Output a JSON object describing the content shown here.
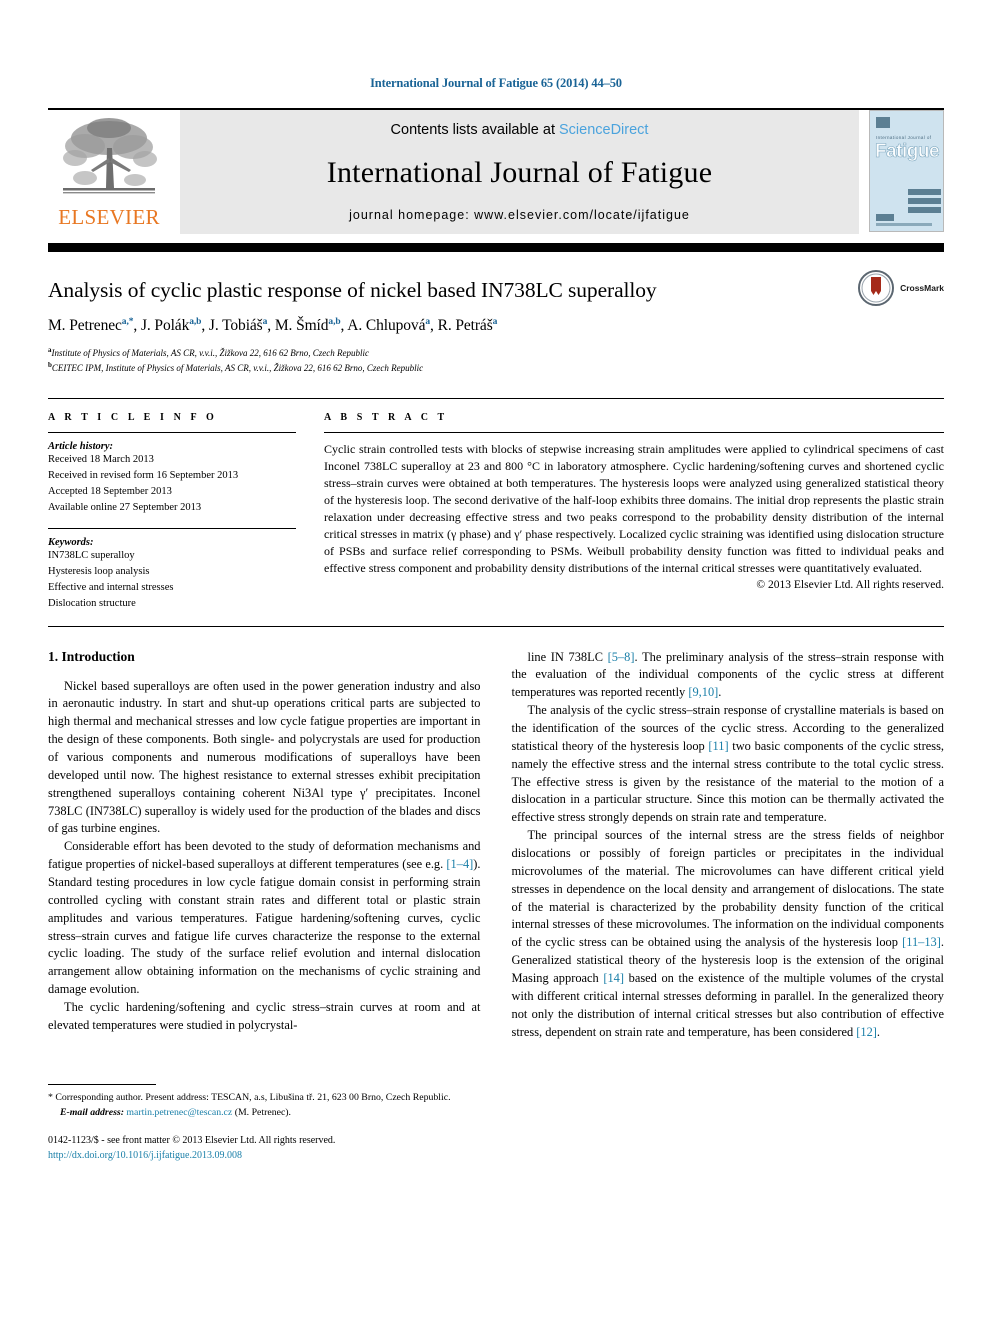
{
  "running_head": "International Journal of Fatigue 65 (2014) 44–50",
  "masthead": {
    "publisher_name": "ELSEVIER",
    "contents_prefix": "Contents lists available at ",
    "contents_link": "ScienceDirect",
    "journal_title": "International Journal of Fatigue",
    "homepage": "journal homepage: www.elsevier.com/locate/ijfatigue",
    "cover": {
      "top_label": "International Journal of",
      "big_word": "Fatigue"
    }
  },
  "article": {
    "title": "Analysis of cyclic plastic response of nickel based IN738LC superalloy",
    "crossmark_label": "CrossMark",
    "authors": [
      {
        "name": "M. Petrenec",
        "sup": "a,*"
      },
      {
        "name": "J. Polák",
        "sup": "a,b"
      },
      {
        "name": "J. Tobiáš",
        "sup": "a"
      },
      {
        "name": "M. Šmíd",
        "sup": "a,b"
      },
      {
        "name": "A. Chlupová",
        "sup": "a"
      },
      {
        "name": "R. Petráš",
        "sup": "a"
      }
    ],
    "affiliations": [
      {
        "marker": "a",
        "text": "Institute of Physics of Materials, AS CR, v.v.i., Žižkova 22, 616 62 Brno, Czech Republic"
      },
      {
        "marker": "b",
        "text": "CEITEC IPM, Institute of Physics of Materials, AS CR, v.v.i., Žižkova 22, 616 62 Brno, Czech Republic"
      }
    ]
  },
  "info": {
    "heading": "A R T I C L E    I N F O",
    "history_label": "Article history:",
    "history": [
      "Received 18 March 2013",
      "Received in revised form 16 September 2013",
      "Accepted 18 September 2013",
      "Available online 27 September 2013"
    ],
    "keywords_label": "Keywords:",
    "keywords": [
      "IN738LC superalloy",
      "Hysteresis loop analysis",
      "Effective and internal stresses",
      "Dislocation structure"
    ]
  },
  "abstract": {
    "heading": "A B S T R A C T",
    "text": "Cyclic strain controlled tests with blocks of stepwise increasing strain amplitudes were applied to cylindrical specimens of cast Inconel 738LC superalloy at 23 and 800 °C in laboratory atmosphere. Cyclic hardening/softening curves and shortened cyclic stress–strain curves were obtained at both temperatures. The hysteresis loops were analyzed using generalized statistical theory of the hysteresis loop. The second derivative of the half-loop exhibits three domains. The initial drop represents the plastic strain relaxation under decreasing effective stress and two peaks correspond to the probability density distribution of the internal critical stresses in matrix (γ phase) and γ′ phase respectively. Localized cyclic straining was identified using dislocation structure of PSBs and surface relief corresponding to PSMs. Weibull probability density function was fitted to individual peaks and effective stress component and probability density distributions of the internal critical stresses were quantitatively evaluated.",
    "copyright": "© 2013 Elsevier Ltd. All rights reserved."
  },
  "body": {
    "section1_heading": "1. Introduction",
    "left_paragraphs": [
      "Nickel based superalloys are often used in the power generation industry and also in aeronautic industry. In start and shut-up operations critical parts are subjected to high thermal and mechanical stresses and low cycle fatigue properties are important in the design of these components. Both single- and polycrystals are used for production of various components and numerous modifications of superalloys have been developed until now. The highest resistance to external stresses exhibit precipitation strengthened superalloys containing coherent Ni3Al type γ′ precipitates. Inconel 738LC (IN738LC) superalloy is widely used for the production of the blades and discs of gas turbine engines.",
      "Considerable effort has been devoted to the study of deformation mechanisms and fatigue properties of nickel-based superalloys at different temperatures (see e.g. [1–4]). Standard testing procedures in low cycle fatigue domain consist in performing strain controlled cycling with constant strain rates and different total or plastic strain amplitudes and various temperatures. Fatigue hardening/softening curves, cyclic stress–strain curves and fatigue life curves characterize the response to the external cyclic loading. The study of the surface relief evolution and internal dislocation arrangement allow obtaining information on the mechanisms of cyclic straining and damage evolution.",
      "The cyclic hardening/softening and cyclic stress–strain curves at room and at elevated temperatures were studied in polycrystal-"
    ],
    "right_paragraphs": [
      "line IN 738LC [5–8]. The preliminary analysis of the stress–strain response with the evaluation of the individual components of the cyclic stress at different temperatures was reported recently [9,10].",
      "The analysis of the cyclic stress–strain response of crystalline materials is based on the identification of the sources of the cyclic stress. According to the generalized statistical theory of the hysteresis loop [11] two basic components of the cyclic stress, namely the effective stress and the internal stress contribute to the total cyclic stress. The effective stress is given by the resistance of the material to the motion of a dislocation in a particular structure. Since this motion can be thermally activated the effective stress strongly depends on strain rate and temperature.",
      "The principal sources of the internal stress are the stress fields of neighbor dislocations or possibly of foreign particles or precipitates in the individual microvolumes of the material. The microvolumes can have different critical yield stresses in dependence on the local density and arrangement of dislocations. The state of the material is characterized by the probability density function of the critical internal stresses of these microvolumes. The information on the individual components of the cyclic stress can be obtained using the analysis of the hysteresis loop [11–13]. Generalized statistical theory of the hysteresis loop is the extension of the original Masing approach [14] based on the existence of the multiple volumes of the crystal with different critical internal stresses deforming in parallel. In the generalized theory not only the distribution of internal critical stresses but also contribution of effective stress, dependent on strain rate and temperature, has been considered [12]."
    ]
  },
  "footnote": {
    "corresponding": "* Corresponding author. Present address: TESCAN, a.s, Libušina tř. 21, 623 00 Brno, Czech Republic.",
    "email_label": "E-mail address:",
    "email": "martin.petrenec@tescan.cz",
    "email_suffix": "(M. Petrenec).",
    "issn_line": "0142-1123/$ - see front matter © 2013 Elsevier Ltd. All rights reserved.",
    "doi": "http://dx.doi.org/10.1016/j.ijfatigue.2013.09.008"
  },
  "colors": {
    "link_blue": "#1a7fa8",
    "header_blue": "#1a6496",
    "sciencedirect_blue": "#4ba3dd",
    "elsevier_orange": "#e87722"
  }
}
